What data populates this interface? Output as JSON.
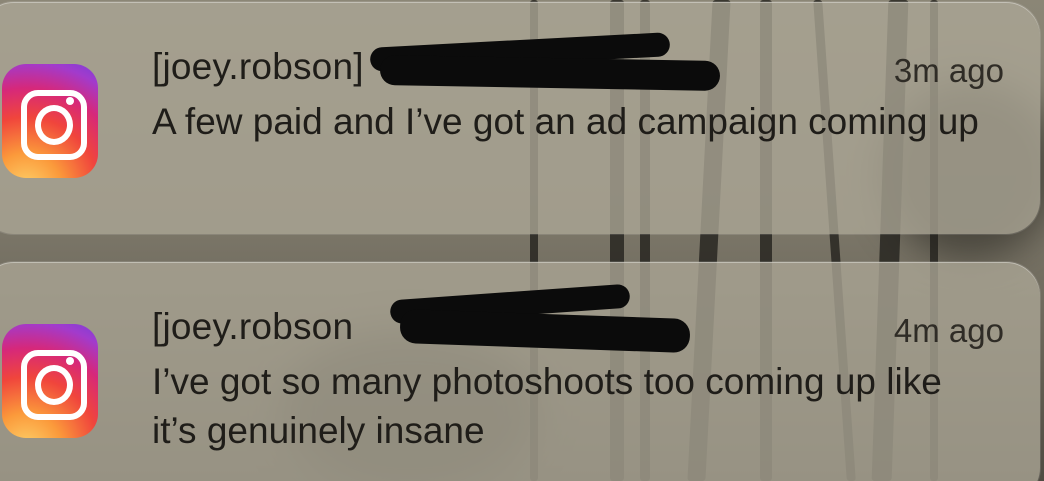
{
  "notifications": [
    {
      "app_icon": "instagram-icon",
      "title": "[joey.robson]",
      "time": "3m ago",
      "message": "A few paid and I’ve got an ad campaign coming up"
    },
    {
      "app_icon": "instagram-icon",
      "title": "[joey.robson",
      "time": "4m ago",
      "message": "I’ve got so many photoshoots too coming up like it’s genuinely insane"
    }
  ],
  "colors": {
    "card_background": "#aca696",
    "text": "#1f1d19",
    "redaction": "#0b0b0b"
  }
}
